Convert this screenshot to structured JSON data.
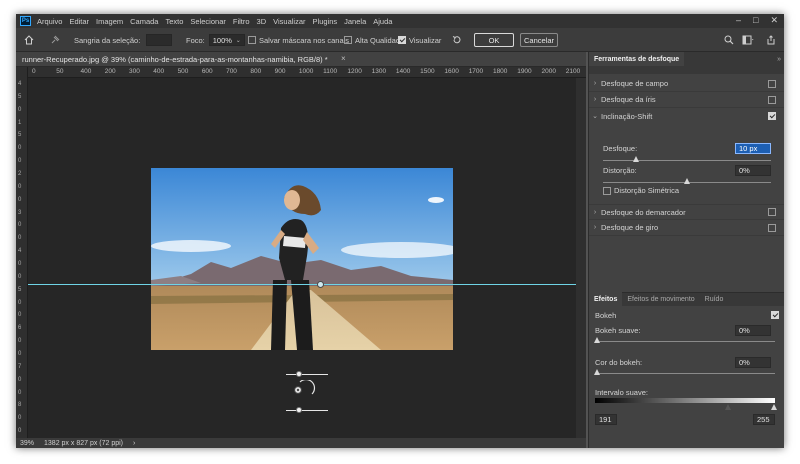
{
  "menubar": {
    "logo": "Ps",
    "items": [
      "Arquivo",
      "Editar",
      "Imagem",
      "Camada",
      "Texto",
      "Selecionar",
      "Filtro",
      "3D",
      "Visualizar",
      "Plugins",
      "Janela",
      "Ajuda"
    ],
    "controls": [
      "–",
      "□",
      "✕"
    ]
  },
  "options_bar": {
    "selection_bleed_label": "Sangria da seleção:",
    "selection_bleed_value": "",
    "focus_label": "Foco:",
    "focus_value": "100%",
    "save_mask_label": "Salvar máscara nos canais",
    "save_mask_checked": false,
    "high_quality_label": "Alta Qualidade",
    "high_quality_checked": false,
    "preview_label": "Visualizar",
    "preview_checked": true,
    "ok_label": "OK",
    "cancel_label": "Cancelar"
  },
  "document": {
    "tab_title": "runner-Recuperado.jpg @ 39% (caminho-de-estrada-para-as-montanhas-namibia, RGB/8) *",
    "close_glyph": "×",
    "ruler_ticks": [
      "0",
      "50",
      "400",
      "200",
      "300",
      "400",
      "500",
      "600",
      "700",
      "800",
      "900",
      "1000",
      "1100",
      "1200",
      "1300",
      "1400",
      "1500",
      "1600",
      "1700",
      "1800",
      "1900",
      "2000",
      "2100"
    ],
    "vertical_ruler_ticks": [
      "4",
      "5",
      "0",
      "1",
      "5",
      "0",
      "0",
      "2",
      "0",
      "0",
      "3",
      "0",
      "0",
      "4",
      "0",
      "0",
      "5",
      "0",
      "0",
      "6",
      "0",
      "0",
      "7",
      "0",
      "0",
      "8",
      "0",
      "0"
    ]
  },
  "status_bar": {
    "zoom": "39%",
    "doc_size": "1382 px x 827 px (72 ppi)",
    "arrow": "›"
  },
  "blur_tools_panel": {
    "tab_label": "Ferramentas de desfoque",
    "items": [
      {
        "label": "Desfoque de campo",
        "expanded": false,
        "checked": false
      },
      {
        "label": "Desfoque da íris",
        "expanded": false,
        "checked": false
      },
      {
        "label": "Inclinação-Shift",
        "expanded": true,
        "checked": true
      },
      {
        "label": "Desfoque do demarcador",
        "expanded": false,
        "checked": false
      },
      {
        "label": "Desfoque de giro",
        "expanded": false,
        "checked": false
      }
    ],
    "tilt_shift": {
      "blur_label": "Desfoque:",
      "blur_value": "10 px",
      "blur_level": 0.2,
      "distortion_label": "Distorção:",
      "distortion_value": "0%",
      "distortion_level": 0.5,
      "symmetric_label": "Distorção Simétrica",
      "symmetric_checked": false
    }
  },
  "effects_panel": {
    "tabs": [
      "Efeitos",
      "Efeitos de movimento",
      "Ruído"
    ],
    "active_tab": "Efeitos",
    "bokeh_label": "Bokeh",
    "bokeh_checked": true,
    "bokeh_soft_label": "Bokeh suave:",
    "bokeh_soft_value": "0%",
    "bokeh_color_label": "Cor do bokeh:",
    "bokeh_color_value": "0%",
    "range_label": "Intervalo suave:",
    "range_low": "191",
    "range_high": "255"
  },
  "colors": {
    "focus_line": "#6fd4e6",
    "highlight_field": "#1d5fb3"
  }
}
